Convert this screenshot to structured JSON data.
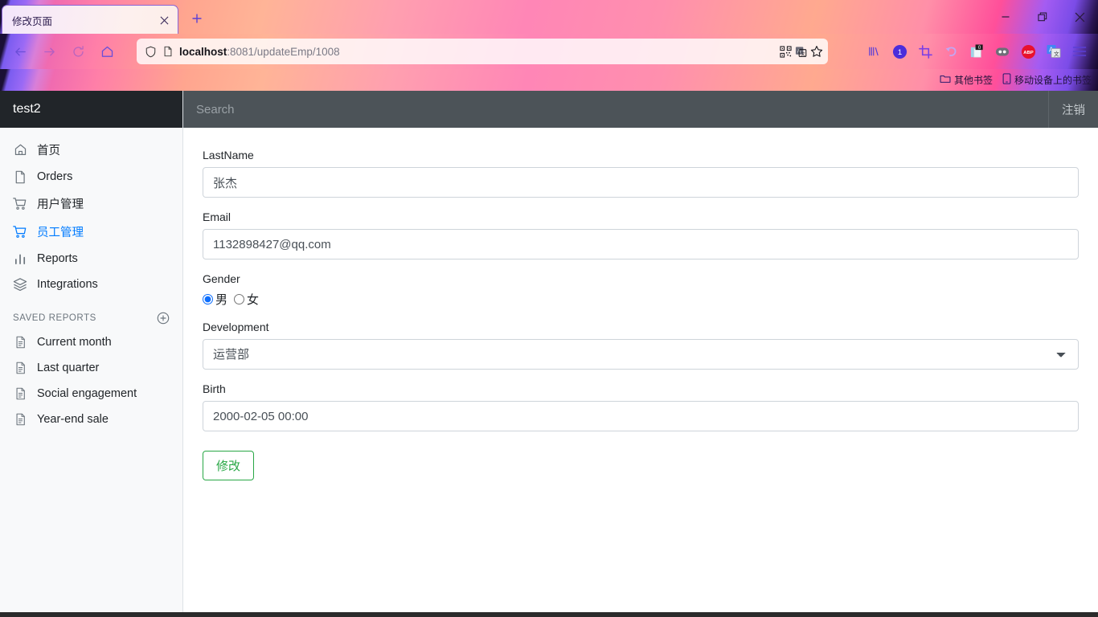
{
  "browser": {
    "tab": {
      "title": "修改页面",
      "close_icon": "close-icon"
    },
    "new_tab_label": "+",
    "window_controls": {
      "minimize": "minimize-icon",
      "maximize": "maximize-icon",
      "close": "close-icon"
    },
    "nav": {
      "back": "back-arrow-icon",
      "forward": "forward-arrow-icon",
      "reload": "reload-icon",
      "home": "home-icon"
    },
    "url": {
      "host": "localhost",
      "path": ":8081/updateEmp/1008",
      "full": "localhost:8081/updateEmp/1008"
    },
    "url_icons": [
      "shield-icon",
      "page-icon",
      "qr-code-icon",
      "translate-icon",
      "bookmark-star-icon"
    ],
    "extensions": [
      {
        "name": "library-icon",
        "badge": ""
      },
      {
        "name": "counter-badge-icon",
        "badge": "1"
      },
      {
        "name": "crop-icon",
        "badge": ""
      },
      {
        "name": "undo-icon",
        "badge": ""
      },
      {
        "name": "notes-icon",
        "badge": "0"
      },
      {
        "name": "dual-circle-icon",
        "badge": ""
      },
      {
        "name": "adblock-icon",
        "badge": "ABP"
      },
      {
        "name": "translate-extension-icon",
        "badge": ""
      },
      {
        "name": "menu-icon",
        "badge": ""
      }
    ],
    "bookmarks": [
      {
        "label": "其他书签",
        "icon": "folder-icon"
      },
      {
        "label": "移动设备上的书签",
        "icon": "mobile-icon"
      }
    ]
  },
  "sidebar": {
    "brand": "test2",
    "items": [
      {
        "label": "首页",
        "icon": "home-icon",
        "active": false
      },
      {
        "label": "Orders",
        "icon": "file-icon",
        "active": false
      },
      {
        "label": "用户管理",
        "icon": "cart-icon",
        "active": false
      },
      {
        "label": "员工管理",
        "icon": "cart-icon",
        "active": true
      },
      {
        "label": "Reports",
        "icon": "bar-chart-icon",
        "active": false
      },
      {
        "label": "Integrations",
        "icon": "layers-icon",
        "active": false
      }
    ],
    "saved_reports": {
      "title": "SAVED REPORTS",
      "add_icon": "plus-circle-icon",
      "items": [
        {
          "label": "Current month",
          "icon": "file-text-icon"
        },
        {
          "label": "Last quarter",
          "icon": "file-text-icon"
        },
        {
          "label": "Social engagement",
          "icon": "file-text-icon"
        },
        {
          "label": "Year-end sale",
          "icon": "file-text-icon"
        }
      ]
    }
  },
  "topnav": {
    "search_placeholder": "Search",
    "search_value": "",
    "logout_label": "注销"
  },
  "form": {
    "lastname": {
      "label": "LastName",
      "value": "张杰",
      "placeholder": ""
    },
    "email": {
      "label": "Email",
      "value": "1132898427@qq.com",
      "placeholder": ""
    },
    "gender": {
      "label": "Gender",
      "options": [
        {
          "label": "男",
          "checked": true
        },
        {
          "label": "女",
          "checked": false
        }
      ]
    },
    "development": {
      "label": "Development",
      "value": "运营部",
      "options": [
        "运营部"
      ]
    },
    "birth": {
      "label": "Birth",
      "value": "2000-02-05 00:00",
      "placeholder": ""
    },
    "submit_label": "修改"
  },
  "colors": {
    "accent_blue": "#007bff",
    "sidebar_bg": "#f8f9fa",
    "brand_bg": "#212529",
    "topnav_bg": "#4c5358",
    "submit_green": "#28a745",
    "border": "#ced4da"
  }
}
